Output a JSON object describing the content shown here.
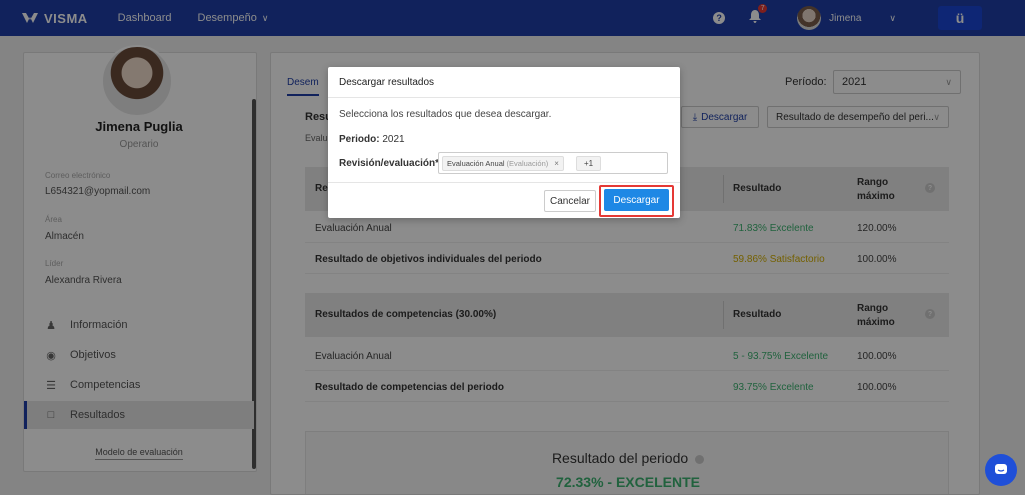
{
  "nav": {
    "brand": "VISMA",
    "dashboard": "Dashboard",
    "desempeno": "Desempeño",
    "notifications_count": "7",
    "user_name": "Jimena",
    "app_badge": "ü"
  },
  "profile": {
    "name": "Jimena Puglia",
    "role": "Operario",
    "email_label": "Correo electrónico",
    "email": "L654321@yopmail.com",
    "area_label": "Área",
    "area": "Almacén",
    "lider_label": "Líder",
    "lider": "Alexandra Rivera"
  },
  "sidebar_menu": [
    {
      "label": "Información",
      "icon": "person-icon"
    },
    {
      "label": "Objetivos",
      "icon": "target-icon"
    },
    {
      "label": "Competencias",
      "icon": "list-icon"
    },
    {
      "label": "Resultados",
      "icon": "clipboard-icon",
      "active": true
    }
  ],
  "sidebar_link": "Modelo de evaluación",
  "main": {
    "tab": "Desem",
    "periodo_label": "Período:",
    "periodo_value": "2021",
    "heading": "Resu",
    "subheading": "Evalu",
    "download_label": "Descargar",
    "results_select": "Resultado de desempeño del peri...",
    "table1": {
      "header_col1": "Res",
      "header_col2": "Resultado",
      "header_col3": "Rango máximo",
      "rows": [
        {
          "name": "Evaluación Anual",
          "result": "71.83% Excelente",
          "max": "120.00%",
          "bold": false,
          "color": "#3cb371"
        },
        {
          "name": "Resultado de objetivos individuales del periodo",
          "result": "59.86% Satisfactorio",
          "max": "100.00%",
          "bold": true,
          "color": "#d4b000"
        }
      ]
    },
    "table2": {
      "header_col1": "Resultados de competencias (30.00%)",
      "header_col2": "Resultado",
      "header_col3": "Rango máximo",
      "rows": [
        {
          "name": "Evaluación Anual",
          "result": "5 - 93.75% Excelente",
          "max": "100.00%",
          "bold": false,
          "color": "#3cb371"
        },
        {
          "name": "Resultado de competencias del periodo",
          "result": "93.75% Excelente",
          "max": "100.00%",
          "bold": true,
          "color": "#3cb371"
        }
      ]
    },
    "period_result_title": "Resultado del periodo",
    "period_result_value": "72.33% - EXCELENTE",
    "period_result_color": "#3cb371"
  },
  "modal": {
    "title": "Descargar resultados",
    "description": "Selecciona los resultados que desea descargar.",
    "periodo_label": "Periodo:",
    "periodo_value": "2021",
    "revision_label": "Revisión/evaluación*",
    "chip_label": "Evaluación Anual",
    "chip_sub": "(Evaluación)",
    "chip_more": "+1",
    "cancel": "Cancelar",
    "download": "Descargar"
  }
}
